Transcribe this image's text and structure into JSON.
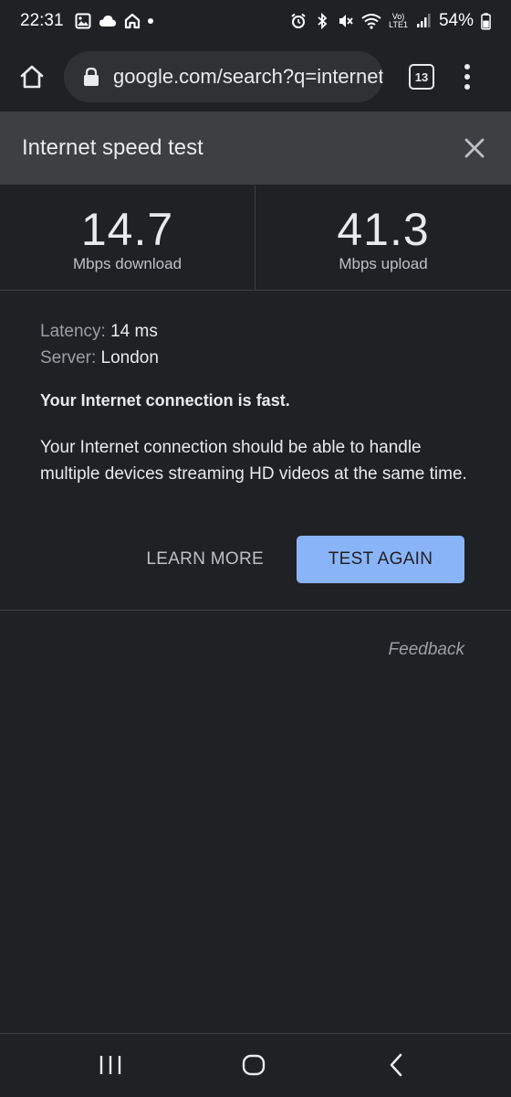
{
  "status_bar": {
    "time": "22:31",
    "battery_percent": "54%",
    "network_label_top": "Vo)",
    "network_label_bottom": "LTE1"
  },
  "browser": {
    "url": "google.com/search?q=internet+speed+test",
    "tab_count": "13"
  },
  "speed_test": {
    "title": "Internet speed test",
    "download_value": "14.7",
    "download_unit": "Mbps download",
    "upload_value": "41.3",
    "upload_unit": "Mbps upload",
    "latency_label": "Latency:",
    "latency_value": "14 ms",
    "server_label": "Server:",
    "server_value": "London",
    "summary": "Your Internet connection is fast.",
    "description": "Your Internet connection should be able to handle multiple devices streaming HD videos at the same time.",
    "learn_more_label": "LEARN MORE",
    "test_again_label": "TEST AGAIN",
    "feedback_label": "Feedback"
  },
  "colors": {
    "background": "#202124",
    "header": "#3c4043",
    "accent": "#8ab4f8"
  }
}
